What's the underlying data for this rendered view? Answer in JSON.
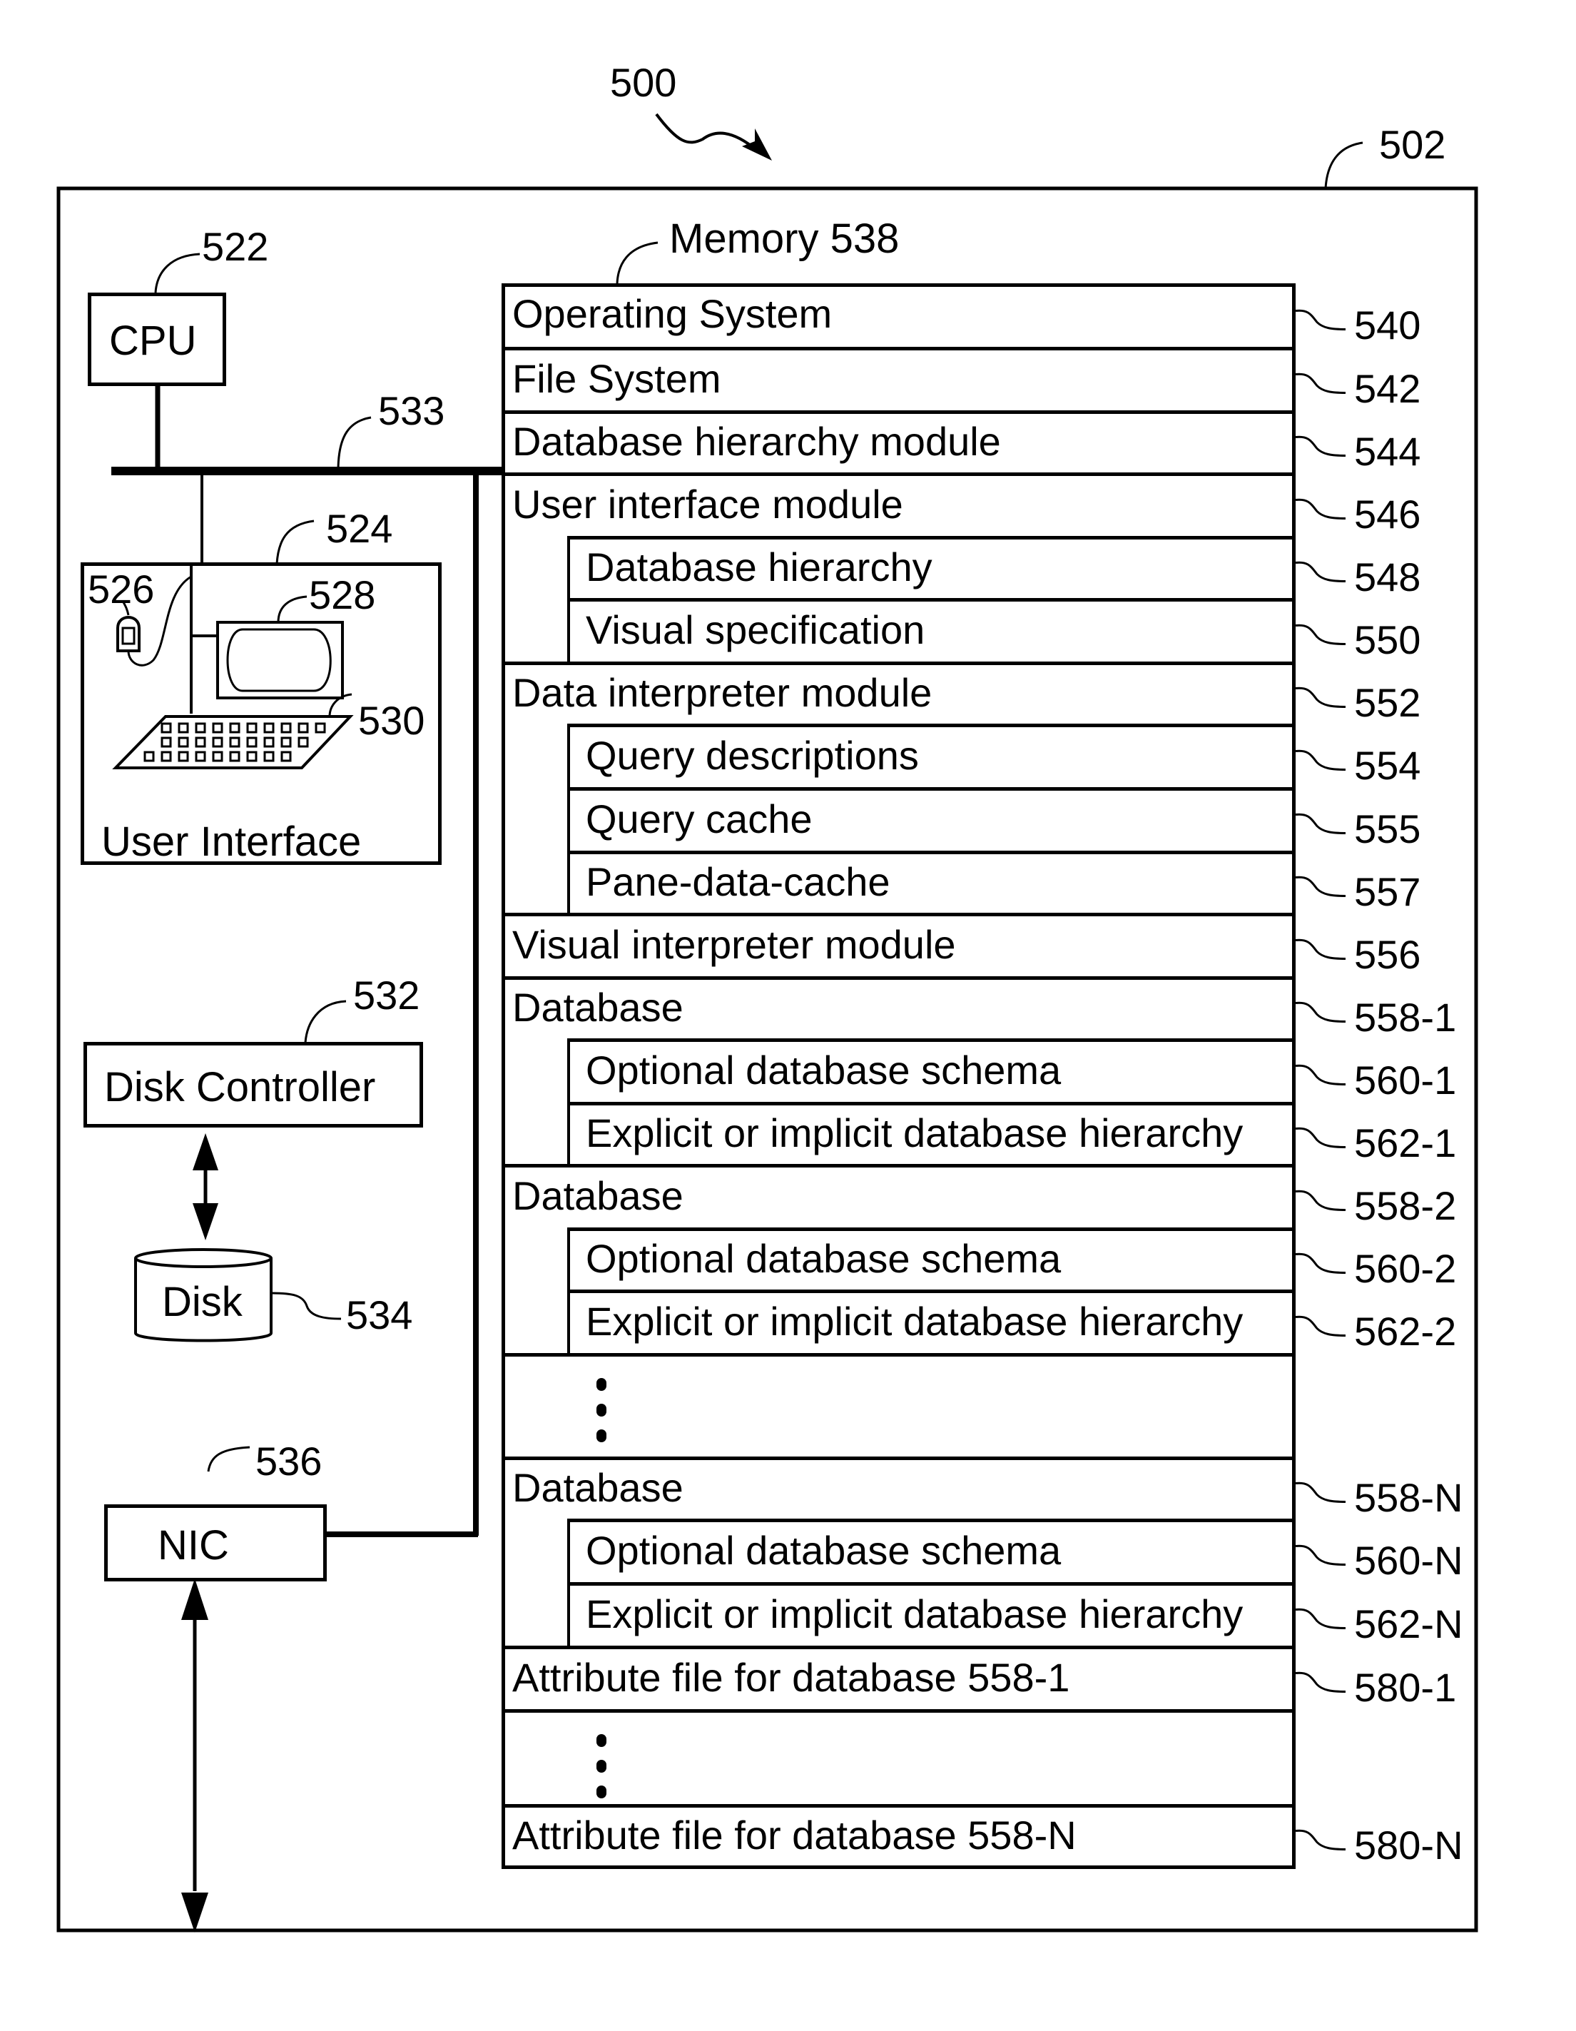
{
  "figure": {
    "figure_ref": "500",
    "system_ref": "502"
  },
  "components": {
    "cpu": {
      "label": "CPU",
      "ref": "522"
    },
    "bus": {
      "ref": "533"
    },
    "user_interface": {
      "label": "User Interface",
      "ref": "524",
      "mouse_ref": "526",
      "display_ref": "528",
      "keyboard_ref": "530"
    },
    "disk_controller": {
      "label": "Disk Controller",
      "ref": "532"
    },
    "disk": {
      "label": "Disk",
      "ref": "534"
    },
    "nic": {
      "label": "NIC",
      "ref": "536"
    }
  },
  "memory": {
    "title": "Memory 538",
    "rows": [
      {
        "label": "Operating System",
        "ref": "540",
        "indent": false
      },
      {
        "label": "File System",
        "ref": "542",
        "indent": false
      },
      {
        "label": "Database hierarchy module",
        "ref": "544",
        "indent": false
      },
      {
        "label": "User interface module",
        "ref": "546",
        "indent": false
      },
      {
        "label": "Database hierarchy",
        "ref": "548",
        "indent": true
      },
      {
        "label": "Visual specification",
        "ref": "550",
        "indent": true
      },
      {
        "label": "Data interpreter module",
        "ref": "552",
        "indent": false
      },
      {
        "label": "Query descriptions",
        "ref": "554",
        "indent": true
      },
      {
        "label": "Query cache",
        "ref": "555",
        "indent": true
      },
      {
        "label": "Pane-data-cache",
        "ref": "557",
        "indent": true
      },
      {
        "label": "Visual interpreter module",
        "ref": "556",
        "indent": false
      },
      {
        "label": "Database",
        "ref": "558-1",
        "indent": false
      },
      {
        "label": "Optional database schema",
        "ref": "560-1",
        "indent": true
      },
      {
        "label": "Explicit or implicit database hierarchy",
        "ref": "562-1",
        "indent": true
      },
      {
        "label": "Database",
        "ref": "558-2",
        "indent": false
      },
      {
        "label": "Optional database schema",
        "ref": "560-2",
        "indent": true
      },
      {
        "label": "Explicit or implicit database hierarchy",
        "ref": "562-2",
        "indent": true
      },
      {
        "label": "",
        "ref": "",
        "indent": false,
        "ellipsis": true
      },
      {
        "label": "Database",
        "ref": "558-N",
        "indent": false
      },
      {
        "label": "Optional database schema",
        "ref": "560-N",
        "indent": true
      },
      {
        "label": "Explicit or implicit database hierarchy",
        "ref": "562-N",
        "indent": true
      },
      {
        "label": "Attribute file for database 558-1",
        "ref": "580-1",
        "indent": false
      },
      {
        "label": "",
        "ref": "",
        "indent": false,
        "ellipsis": true
      },
      {
        "label": "Attribute file for database 558-N",
        "ref": "580-N",
        "indent": false
      }
    ]
  }
}
